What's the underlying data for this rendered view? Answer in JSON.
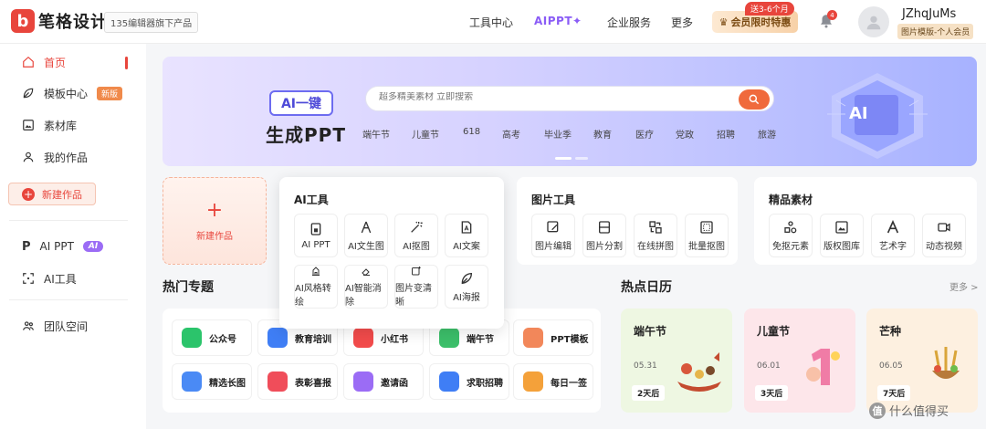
{
  "header": {
    "logo_mark": "b",
    "logo_text": "笔格设计",
    "logo_sub": "135编辑器旗下产品",
    "nav": [
      "工具中心",
      "AIPPT✦",
      "企业服务",
      "更多"
    ],
    "vip_label": "会员限时特惠",
    "vip_tag": "送3-6个月",
    "bell_count": "4",
    "username": "JZhqJuMs",
    "user_tag": "图片模版-个人会员"
  },
  "sidebar": {
    "items": [
      {
        "label": "首页",
        "icon": "home-icon"
      },
      {
        "label": "模板中心",
        "icon": "leaf-icon",
        "badge": "新版"
      },
      {
        "label": "素材库",
        "icon": "image-icon"
      },
      {
        "label": "我的作品",
        "icon": "user-icon"
      },
      {
        "label": "新建作品",
        "icon": "plus-circle-icon"
      },
      {
        "label": "AI PPT",
        "icon": "ppt-icon",
        "badge": "AI"
      },
      {
        "label": "AI工具",
        "icon": "ai-scan-icon"
      },
      {
        "label": "团队空间",
        "icon": "team-icon"
      }
    ]
  },
  "banner": {
    "ai_label": "AI一键",
    "title": "生成PPT",
    "search_placeholder": "超多精美素材 立即搜索",
    "tags": [
      "端午节",
      "儿童节",
      "618",
      "高考",
      "毕业季",
      "教育",
      "医疗",
      "党政",
      "招聘",
      "旅游"
    ],
    "badge": "AI"
  },
  "new_card": {
    "label": "新建作品"
  },
  "ai_tools": {
    "title": "AI工具",
    "items": [
      "AI PPT",
      "AI文生图",
      "AI抠图",
      "AI文案",
      "AI风格转绘",
      "AI智能消除",
      "图片变清晰",
      "AI海报"
    ]
  },
  "image_tools": {
    "title": "图片工具",
    "items": [
      "图片编辑",
      "图片分割",
      "在线拼图",
      "批量抠图"
    ]
  },
  "materials": {
    "title": "精品素材",
    "items": [
      "免抠元素",
      "版权图库",
      "艺术字",
      "动态视频"
    ]
  },
  "hot_topics": {
    "title": "热门专题",
    "items": [
      {
        "label": "公众号",
        "color": "#2bc46b"
      },
      {
        "label": "教育培训",
        "color": "#3f7ef5"
      },
      {
        "label": "小红书",
        "color": "#f24b4b"
      },
      {
        "label": "端午节",
        "color": "#3cbf6a"
      },
      {
        "label": "PPT模板",
        "color": "#f2875a"
      },
      {
        "label": "精选长图",
        "color": "#4a8af5"
      },
      {
        "label": "表彰喜报",
        "color": "#f04d5a"
      },
      {
        "label": "邀请函",
        "color": "#9b6cf5"
      },
      {
        "label": "求职招聘",
        "color": "#3f7ef5"
      },
      {
        "label": "每日一签",
        "color": "#f4a13a"
      }
    ]
  },
  "calendar": {
    "title": "热点日历",
    "more": "更多 >",
    "items": [
      {
        "name": "端午节",
        "date": "05.31",
        "left": "2天后",
        "bg": "#eef7e2"
      },
      {
        "name": "儿童节",
        "date": "06.01",
        "left": "3天后",
        "bg": "#fde6ea"
      },
      {
        "name": "芒种",
        "date": "06.05",
        "left": "7天后",
        "bg": "#fdf0e0"
      }
    ]
  },
  "watermark": "什么值得买"
}
